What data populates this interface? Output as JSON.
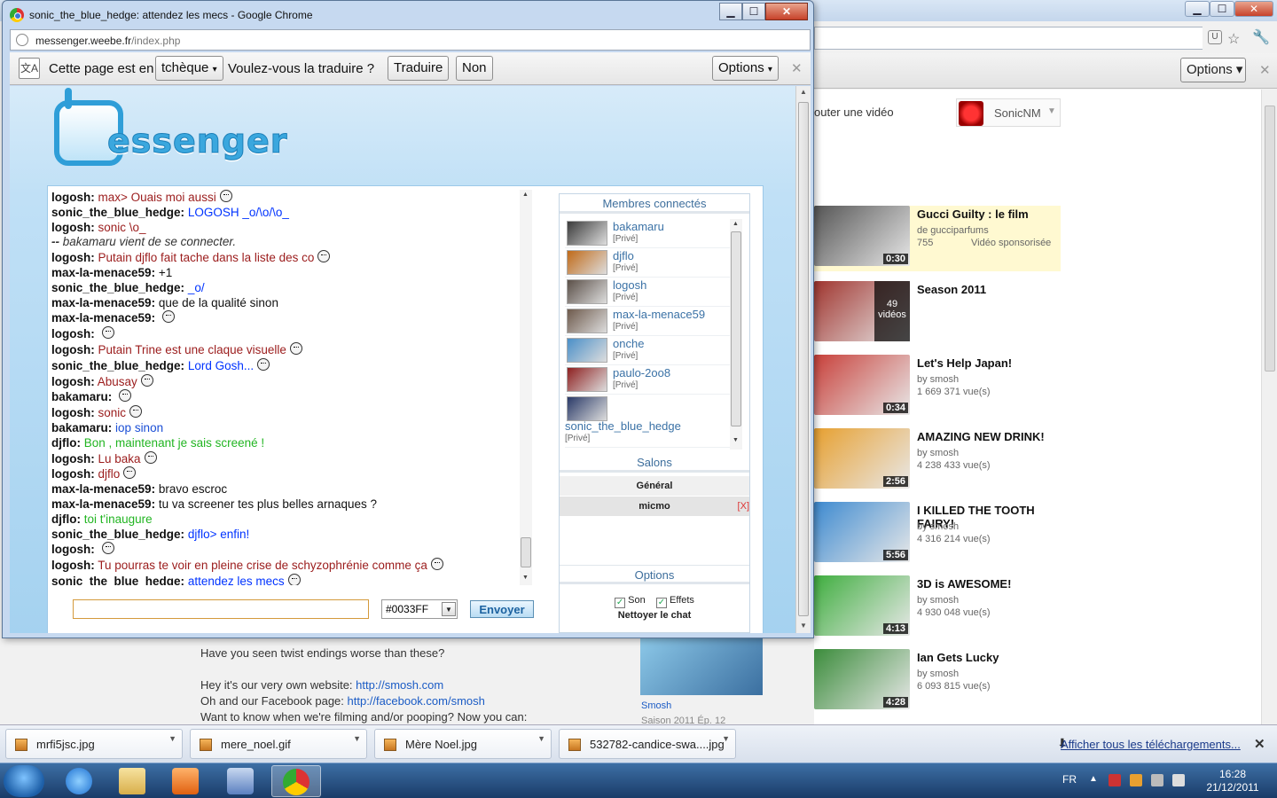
{
  "fg_window": {
    "title": "sonic_the_blue_hedge: attendez les mecs - Google Chrome",
    "minimize": "▁",
    "maximize": "☐",
    "close": "✕",
    "url_host": "messenger.weebe.fr",
    "url_path": "/index.php",
    "infobar": {
      "text1": "Cette page est en",
      "language": "tchèque",
      "text2": "Voulez-vous la traduire ?",
      "translate": "Traduire",
      "no": "Non",
      "options": "Options",
      "close": "✕"
    }
  },
  "logo_text": "essenger",
  "chat": {
    "lines": [
      {
        "name": "logosh:",
        "text": "max> Ouais moi aussi",
        "color": "#9b1c1c",
        "smiley": true
      },
      {
        "name": "sonic_the_blue_hedge:",
        "text": "LOGOSH _o/\\o/\\o_",
        "color": "#0033FF",
        "smiley": false
      },
      {
        "name": "logosh:",
        "text": "sonic \\o_",
        "color": "#9b1c1c",
        "smiley": false
      },
      {
        "name": "--",
        "text": "bakamaru vient de se connecter.",
        "color": "#333",
        "smiley": false,
        "system": true
      },
      {
        "name": "logosh:",
        "text": "Putain djflo fait tache dans la liste des co",
        "color": "#9b1c1c",
        "smiley": true
      },
      {
        "name": "max-la-menace59:",
        "text": "+1",
        "color": "#111",
        "smiley": false
      },
      {
        "name": "sonic_the_blue_hedge:",
        "text": "_o/",
        "color": "#0033FF",
        "smiley": false
      },
      {
        "name": "max-la-menace59:",
        "text": "que de la qualité sinon",
        "color": "#111",
        "smiley": false
      },
      {
        "name": "max-la-menace59:",
        "text": "",
        "color": "#111",
        "smiley": true
      },
      {
        "name": "logosh:",
        "text": "",
        "color": "#9b1c1c",
        "smiley": true
      },
      {
        "name": "logosh:",
        "text": "Putain Trine est une claque visuelle",
        "color": "#9b1c1c",
        "smiley": true
      },
      {
        "name": "sonic_the_blue_hedge:",
        "text": "Lord Gosh...",
        "color": "#0033FF",
        "smiley": true
      },
      {
        "name": "logosh:",
        "text": "Abusay",
        "color": "#9b1c1c",
        "smiley": true
      },
      {
        "name": "bakamaru:",
        "text": "",
        "color": "#1b4fd6",
        "smiley": true
      },
      {
        "name": "logosh:",
        "text": "sonic",
        "color": "#9b1c1c",
        "smiley": true
      },
      {
        "name": "bakamaru:",
        "text": "iop sinon",
        "color": "#1b4fd6",
        "smiley": false
      },
      {
        "name": "djflo:",
        "text": "Bon , maintenant je sais screené !",
        "color": "#22b522",
        "smiley": false
      },
      {
        "name": "logosh:",
        "text": "Lu baka",
        "color": "#9b1c1c",
        "smiley": true
      },
      {
        "name": "logosh:",
        "text": "djflo",
        "color": "#9b1c1c",
        "smiley": true
      },
      {
        "name": "max-la-menace59:",
        "text": "bravo escroc",
        "color": "#111",
        "smiley": false
      },
      {
        "name": "max-la-menace59:",
        "text": "tu va screener tes plus belles arnaques ?",
        "color": "#111",
        "smiley": false
      },
      {
        "name": "djflo:",
        "text": "toi t'inaugure",
        "color": "#22b522",
        "smiley": false
      },
      {
        "name": "sonic_the_blue_hedge:",
        "text": "djflo> enfin!",
        "color": "#0033FF",
        "smiley": false
      },
      {
        "name": "logosh:",
        "text": "",
        "color": "#9b1c1c",
        "smiley": true
      },
      {
        "name": "logosh:",
        "text": "Tu pourras te voir en pleine crise de schyzophrénie comme ça",
        "color": "#9b1c1c",
        "smiley": true
      },
      {
        "name": "sonic_the_blue_hedge:",
        "text": "attendez les mecs",
        "color": "#0033FF",
        "smiley": true
      }
    ],
    "input_value": "",
    "color_value": "#0033FF",
    "send_label": "Envoyer"
  },
  "sidebar": {
    "members_header": "Membres connectés",
    "members": [
      {
        "name": "bakamaru",
        "status": "[Privé]",
        "avatar_color": "#3a3a3a"
      },
      {
        "name": "djflo",
        "status": "[Privé]",
        "avatar_color": "#c06a18"
      },
      {
        "name": "logosh",
        "status": "[Privé]",
        "avatar_color": "#5b5048"
      },
      {
        "name": "max-la-menace59",
        "status": "[Privé]",
        "avatar_color": "#6e5a4c"
      },
      {
        "name": "onche",
        "status": "[Privé]",
        "avatar_color": "#4a8fc8"
      },
      {
        "name": "paulo-2oo8",
        "status": "[Privé]",
        "avatar_color": "#8e2020"
      },
      {
        "name": "sonic_the_blue_hedge",
        "status": "[Privé]",
        "avatar_color": "#2a3a68"
      }
    ],
    "salons_header": "Salons",
    "salons": [
      {
        "name": "Général"
      },
      {
        "name": "micmo",
        "remove": "[X]"
      }
    ],
    "options_header": "Options",
    "options": {
      "son": "Son",
      "effets": "Effets",
      "clear": "Nettoyer le chat"
    }
  },
  "bg_window": {
    "options": "Options",
    "add_video": "outer une vidéo",
    "user": "SonicNM",
    "videos": [
      {
        "title": "Gucci Guilty : le film",
        "by": "de gucciparfums",
        "views": "755",
        "extra": "Vidéo sponsorisée",
        "duration": "0:30",
        "thumb": "#555"
      },
      {
        "title": "Season 2011",
        "by": "",
        "views": "",
        "extra": "",
        "duration": "",
        "badge": "49 vidéos",
        "thumb": "#a0352f"
      },
      {
        "title": "Let's Help Japan!",
        "by": "by smosh",
        "views": "1 669 371 vue(s)",
        "extra": "",
        "duration": "0:34",
        "thumb": "#c8403a"
      },
      {
        "title": "AMAZING NEW DRINK!",
        "by": "by smosh",
        "views": "4 238 433 vue(s)",
        "extra": "",
        "duration": "2:56",
        "thumb": "#e7a030"
      },
      {
        "title": "I KILLED THE TOOTH FAIRY!",
        "by": "by smosh",
        "views": "4 316 214 vue(s)",
        "extra": "",
        "duration": "5:56",
        "thumb": "#3d8ad0"
      },
      {
        "title": "3D is AWESOME!",
        "by": "by smosh",
        "views": "4 930 048 vue(s)",
        "extra": "",
        "duration": "4:13",
        "thumb": "#3fae3f"
      },
      {
        "title": "Ian Gets Lucky",
        "by": "by smosh",
        "views": "6 093 815 vue(s)",
        "extra": "",
        "duration": "4:28",
        "thumb": "#3b8c3b"
      }
    ],
    "description": [
      "Have you seen twist endings worse than these?",
      "",
      "Hey it's our very own website: ",
      "Oh and our Facebook page: ",
      "Want to know when we're filming and/or pooping? Now you can:"
    ],
    "website_link": "http://smosh.com",
    "facebook_link": "http://facebook.com/smosh",
    "side_caption": "Smosh",
    "side_caption2": "Saison 2011 Ép. 12"
  },
  "downloads": {
    "items": [
      "mrfi5jsc.jpg",
      "mere_noel.gif",
      "Mère Noel.jpg",
      "532782-candice-swa....jpg"
    ],
    "show_all": "Afficher tous les téléchargements..."
  },
  "taskbar": {
    "lang": "FR",
    "time": "16:28",
    "date": "21/12/2011"
  }
}
